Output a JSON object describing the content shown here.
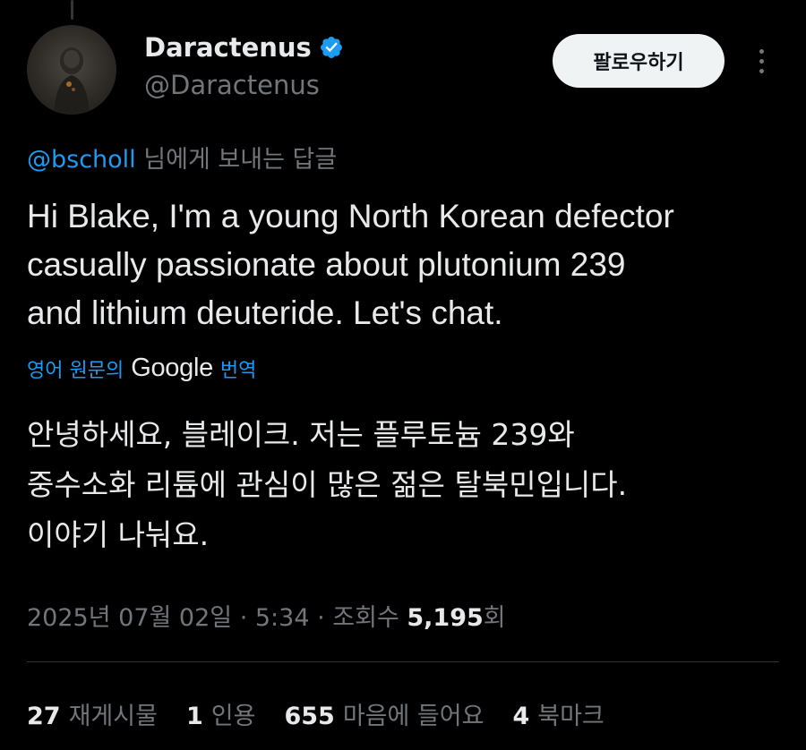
{
  "author": {
    "display_name": "Daractenus",
    "handle": "@Daractenus",
    "verified_icon": "verified-badge-icon",
    "avatar_icon": "avatar-image"
  },
  "actions": {
    "follow_label": "팔로우하기",
    "more_icon": "more-options-icon"
  },
  "reply": {
    "mention": "@bscholl",
    "suffix": "님에게 보내는 답글"
  },
  "tweet": {
    "text_lines": [
      "Hi Blake, I'm a young North Korean defector",
      "casually passionate about plutonium 239",
      "and lithium deuteride. Let's chat."
    ]
  },
  "translation": {
    "prefix": "영어 원문의",
    "brand": "Google",
    "link": "번역",
    "lines": [
      "안녕하세요, 블레이크. 저는 플루토늄 239와",
      "중수소화 리튬에 관심이 많은 젊은 탈북민입니다.",
      "이야기 나눠요."
    ]
  },
  "meta": {
    "date": "2025년 07월 02일",
    "time": "5:34",
    "views_label": "조회수",
    "views_count": "5,195",
    "views_suffix": "회",
    "separator": " · "
  },
  "stats": [
    {
      "count": "27",
      "label": "재게시물"
    },
    {
      "count": "1",
      "label": "인용"
    },
    {
      "count": "655",
      "label": "마음에 들어요"
    },
    {
      "count": "4",
      "label": "북마크"
    }
  ],
  "colors": {
    "background": "#000000",
    "text_primary": "#e7e9ea",
    "text_secondary": "#71767b",
    "accent_blue": "#1d9bf0",
    "button_bg": "#eff3f4",
    "divider": "#2f3336"
  }
}
